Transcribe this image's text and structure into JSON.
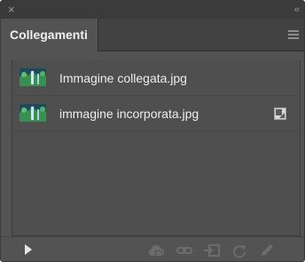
{
  "window": {
    "close_glyph": "×",
    "collapse_glyph": "‹‹"
  },
  "panel": {
    "tab_label": "Collegamenti",
    "menu_icon": "hamburger-menu-icon"
  },
  "links": [
    {
      "name": "Immagine collegata.jpg",
      "thumbnail_icon": "image-thumbnail",
      "status_icon": null
    },
    {
      "name": "immagine incorporata.jpg",
      "thumbnail_icon": "image-thumbnail",
      "status_icon": "embedded-icon"
    }
  ],
  "toolbar": {
    "buttons": [
      {
        "name": "show-options-button",
        "icon": "play-icon",
        "enabled": true
      },
      {
        "name": "cc-libraries-button",
        "icon": "cloud-icon",
        "enabled": false
      },
      {
        "name": "relink-button",
        "icon": "link-icon",
        "enabled": false
      },
      {
        "name": "go-to-link-button",
        "icon": "go-to-link-icon",
        "enabled": false
      },
      {
        "name": "update-link-button",
        "icon": "refresh-icon",
        "enabled": false
      },
      {
        "name": "edit-original-button",
        "icon": "pencil-icon",
        "enabled": false
      }
    ]
  },
  "colors": {
    "panel_bg": "#535353",
    "tabbar_bg": "#424242",
    "text": "#ededed",
    "disabled_icon": "#6c6c6c"
  }
}
